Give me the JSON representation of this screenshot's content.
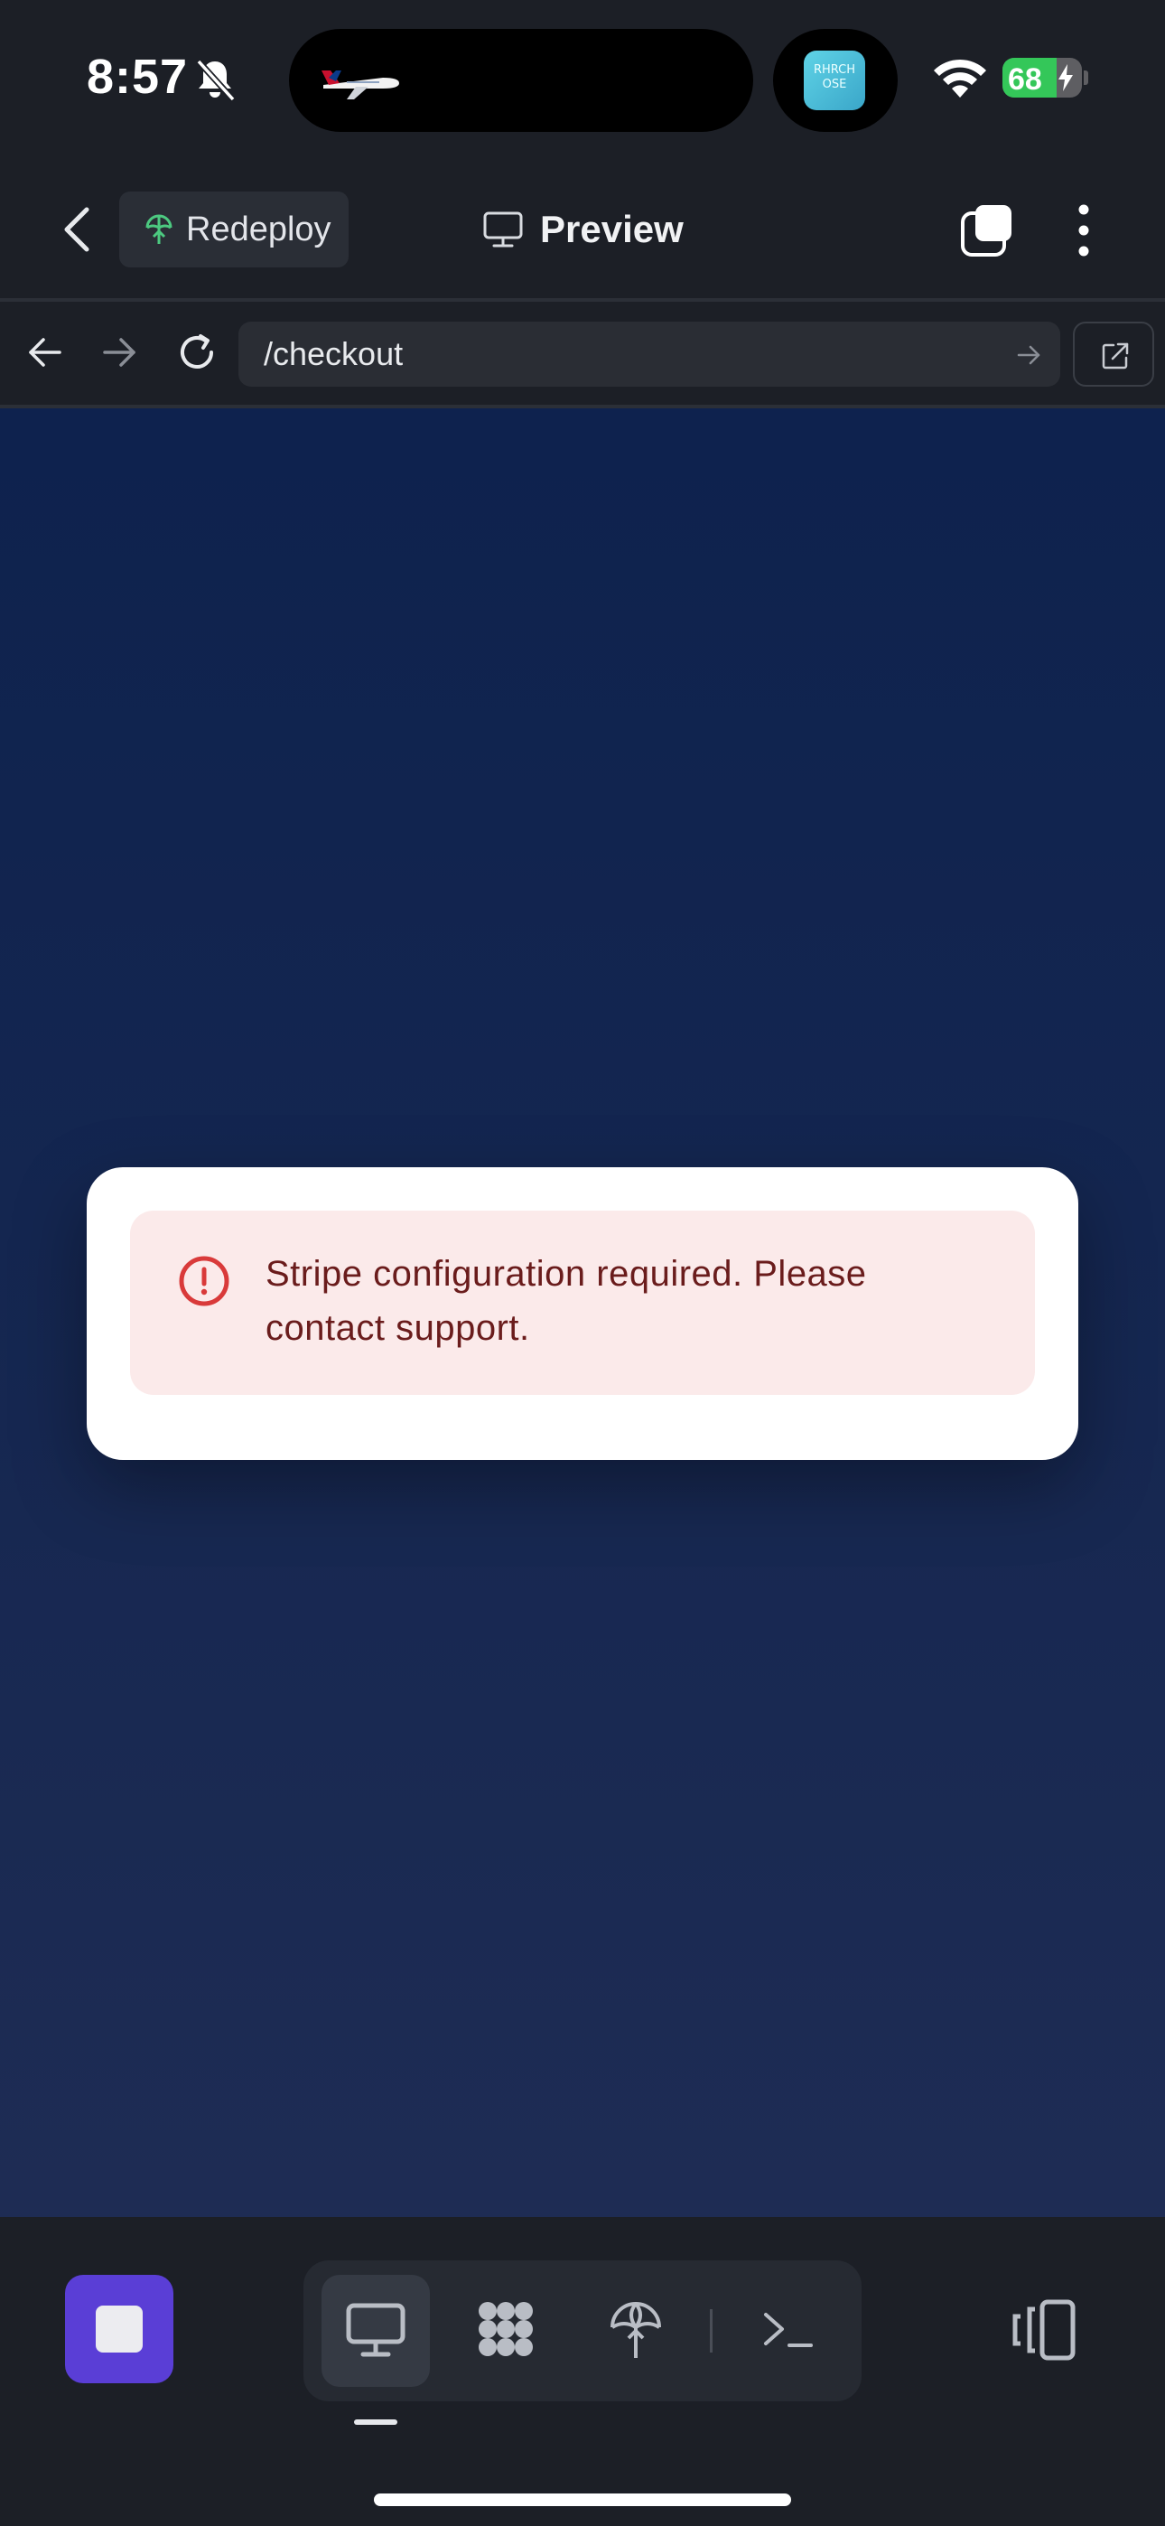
{
  "status_bar": {
    "time": "8:57",
    "battery_percent": "68",
    "battery_level": 0.68,
    "live_activity_tile": "RHRCH OSE"
  },
  "header": {
    "redeploy_label": "Redeploy",
    "title": "Preview"
  },
  "url_bar": {
    "path": "/checkout"
  },
  "page": {
    "error_message": "Stripe configuration required. Please contact support."
  },
  "colors": {
    "accent": "#5a3ed6",
    "error_text": "#6a1c1c",
    "error_bg": "#fbeaea",
    "error_icon": "#d93a3a",
    "redeploy_icon": "#4cc980"
  },
  "toolbar": {
    "items": [
      {
        "icon": "monitor-icon",
        "active": true
      },
      {
        "icon": "integrations-icon",
        "active": false
      },
      {
        "icon": "deploy-icon",
        "active": false
      },
      {
        "icon": "terminal-icon",
        "active": false
      }
    ]
  }
}
